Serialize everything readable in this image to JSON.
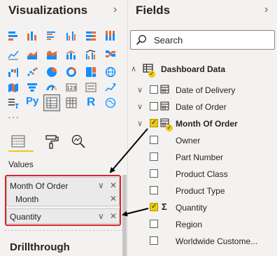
{
  "visualizations": {
    "title": "Visualizations",
    "values_label": "Values",
    "wells": [
      {
        "field": "Month Of Order",
        "sub": "Month"
      },
      {
        "field": "Quantity"
      }
    ],
    "drillthrough": "Drillthrough",
    "more": "···"
  },
  "fields": {
    "title": "Fields",
    "search_placeholder": "Search",
    "table": "Dashboard Data",
    "items": [
      {
        "label": "Date of Delivery",
        "checked": false
      },
      {
        "label": "Date of Order",
        "checked": false
      },
      {
        "label": "Month Of Order",
        "checked": true
      },
      {
        "label": "Owner",
        "checked": false
      },
      {
        "label": "Part Number",
        "checked": false
      },
      {
        "label": "Product Class",
        "checked": false
      },
      {
        "label": "Product Type",
        "checked": false
      },
      {
        "label": "Quantity",
        "checked": true
      },
      {
        "label": "Region",
        "checked": false
      },
      {
        "label": "Worldwide Custome...",
        "checked": false
      }
    ]
  },
  "glyphs": {
    "sigma": "Σ",
    "py": "Py",
    "r": "R"
  },
  "colors": {
    "accent": "#f2c811",
    "highlight": "#d9232e",
    "arrow": "#000000"
  }
}
